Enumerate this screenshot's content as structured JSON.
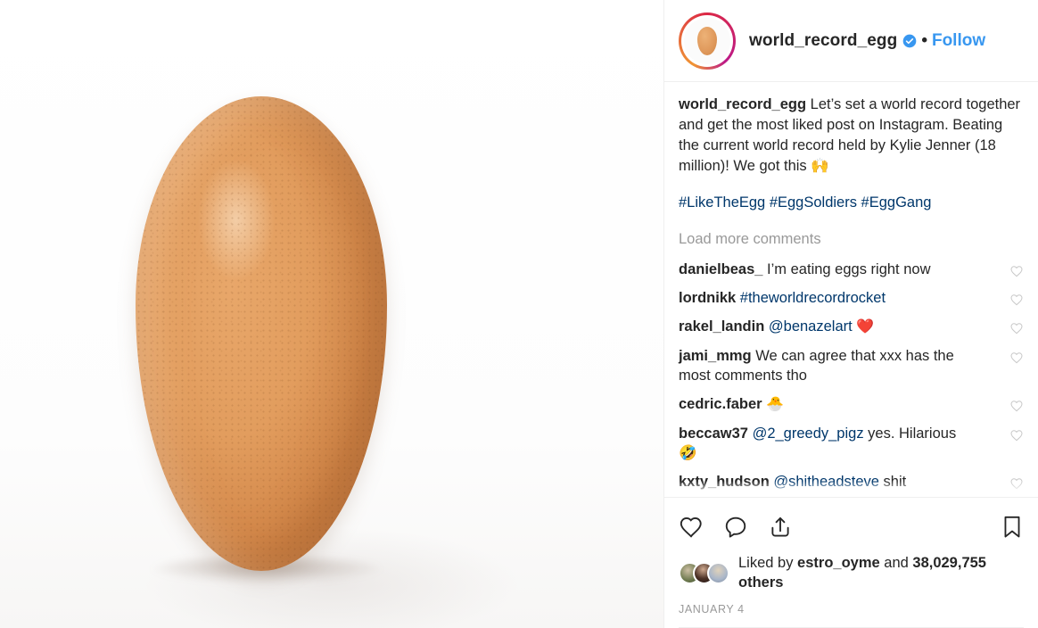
{
  "post": {
    "media": {
      "alt": "brown-egg-photo",
      "icon": "egg-image"
    },
    "header": {
      "username": "world_record_egg",
      "verified_badge": "verified-badge-icon",
      "separator": "•",
      "follow_label": "Follow",
      "avatar_icon": "profile-avatar-egg"
    },
    "caption": {
      "author": "world_record_egg",
      "text": "Let’s set a world record together and get the most liked post on Instagram. Beating the current world record held by Kylie Jenner (18 million)! We got this 🙌",
      "hashtags": "#LikeTheEgg #EggSoldiers #EggGang"
    },
    "load_more_label": "Load more comments",
    "comments": [
      {
        "user": "danielbeas_",
        "text": " I’m eating eggs right now",
        "link": "",
        "tail": ""
      },
      {
        "user": "lordnikk",
        "text": " ",
        "link": "#theworldrecordrocket",
        "tail": ""
      },
      {
        "user": "rakel_landin",
        "text": " ",
        "link": "@benazelart",
        "tail": " ❤️"
      },
      {
        "user": "jami_mmg",
        "text": " We can agree that xxx has the most comments tho",
        "link": "",
        "tail": ""
      },
      {
        "user": "cedric.faber",
        "text": " 🐣",
        "link": "",
        "tail": ""
      },
      {
        "user": "beccaw37",
        "text": " ",
        "link": "@2_greedy_pigz",
        "tail": " yes. Hilarious 🤣"
      },
      {
        "user": "kxty_hudson",
        "text": " ",
        "link": "@shitheadsteve",
        "tail": " shit"
      }
    ],
    "actions": {
      "like": "heart-icon",
      "comment": "comment-bubble-icon",
      "share": "share-icon",
      "save": "bookmark-icon"
    },
    "likes": {
      "prefix": "Liked by ",
      "first_liker": "estro_oyme",
      "suffix": " and ",
      "count": "38,029,755",
      "others_label": " others"
    },
    "timestamp": "JANUARY 4",
    "colors": {
      "accent_link": "#3897f0",
      "link_navy": "#00376b",
      "text": "#262626",
      "muted": "#999999",
      "verified_blue": "#3897f0",
      "border": "#efefef"
    }
  }
}
